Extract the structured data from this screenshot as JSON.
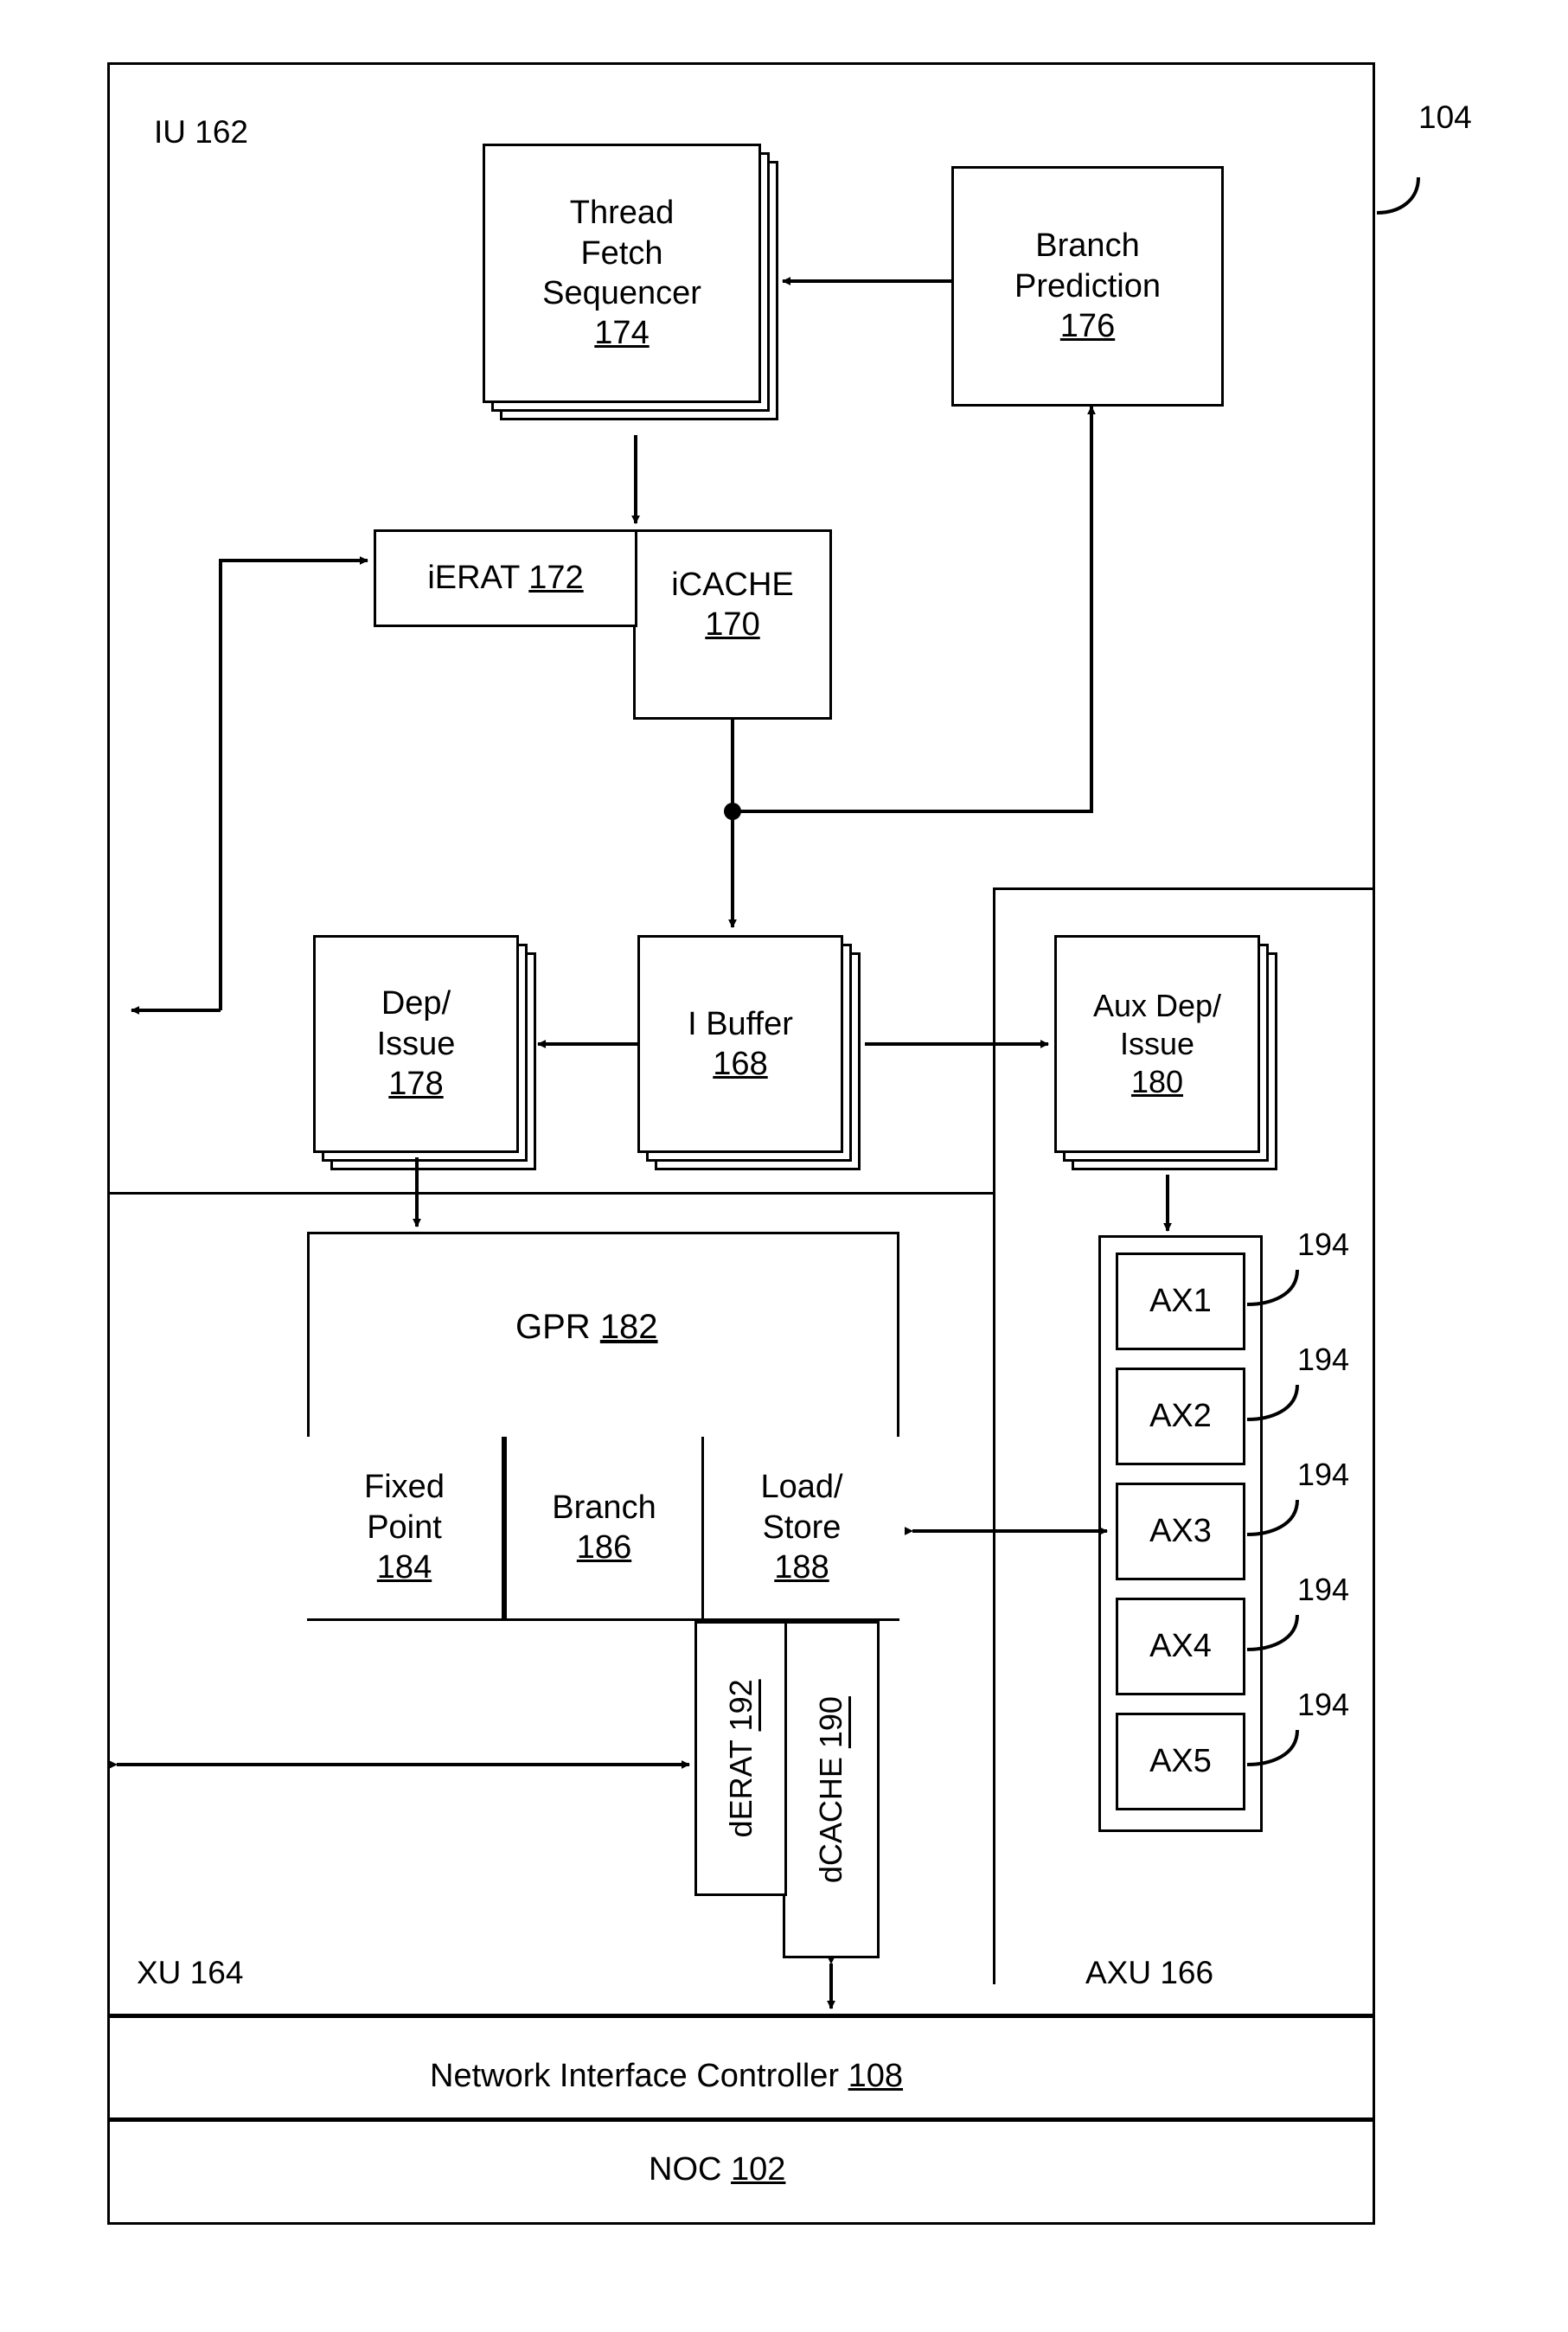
{
  "figure": {
    "outer_ref": "104",
    "units": {
      "iu": "IU 162",
      "xu": "XU 164",
      "axu": "AXU 166"
    },
    "blocks": {
      "thread_fetch_sequencer": {
        "line1": "Thread",
        "line2": "Fetch",
        "line3": "Sequencer",
        "num": "174"
      },
      "branch_prediction": {
        "line1": "Branch",
        "line2": "Prediction",
        "num": "176"
      },
      "ierat": {
        "line1": "iERAT",
        "num": "172"
      },
      "icache": {
        "line1": "iCACHE",
        "num": "170"
      },
      "dep_issue": {
        "line1": "Dep/",
        "line2": "Issue",
        "num": "178"
      },
      "i_buffer": {
        "line1": "I Buffer",
        "num": "168"
      },
      "aux_dep_issue": {
        "line1": "Aux Dep/",
        "line2": "Issue",
        "num": "180"
      },
      "gpr": {
        "line1": "GPR",
        "num": "182"
      },
      "fixed_point": {
        "line1": "Fixed",
        "line2": "Point",
        "num": "184"
      },
      "branch": {
        "line1": "Branch",
        "num": "186"
      },
      "load_store": {
        "line1": "Load/",
        "line2": "Store",
        "num": "188"
      },
      "derat": {
        "line1": "dERAT",
        "num": "192"
      },
      "dcache": {
        "line1": "dCACHE",
        "num": "190"
      },
      "nic": {
        "line1": "Network Interface Controller",
        "num": "108"
      },
      "noc": {
        "line1": "NOC",
        "num": "102"
      }
    },
    "aux_units": [
      {
        "label": "AX1",
        "ref": "194"
      },
      {
        "label": "AX2",
        "ref": "194"
      },
      {
        "label": "AX3",
        "ref": "194"
      },
      {
        "label": "AX4",
        "ref": "194"
      },
      {
        "label": "AX5",
        "ref": "194"
      }
    ],
    "colors": {
      "ink": "#000000",
      "paper": "#ffffff"
    }
  }
}
